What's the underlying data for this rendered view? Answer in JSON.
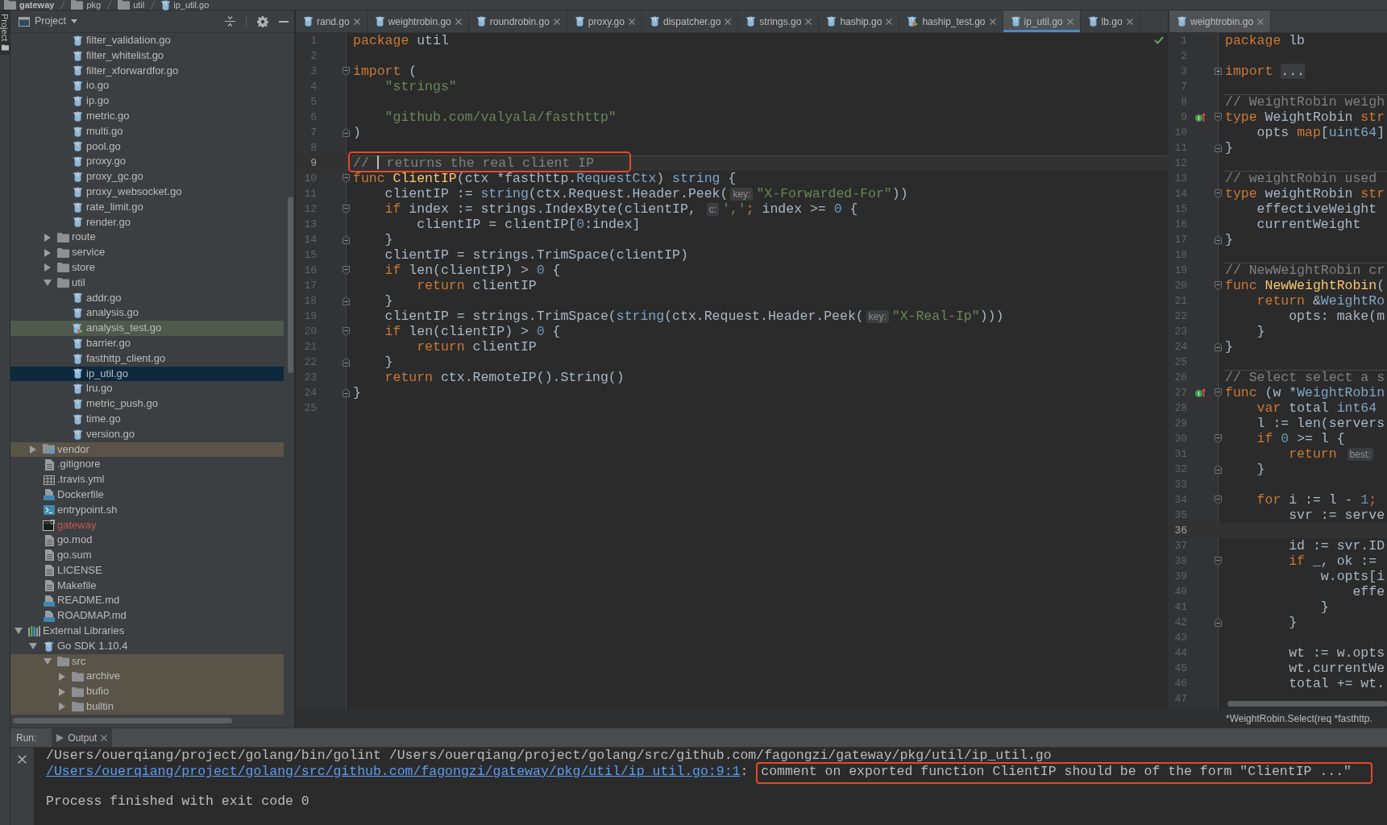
{
  "breadcrumb": [
    {
      "label": "gateway",
      "kind": "project"
    },
    {
      "label": "pkg",
      "kind": "folder"
    },
    {
      "label": "util",
      "kind": "folder"
    },
    {
      "label": "ip_util.go",
      "kind": "go"
    }
  ],
  "tool_strip": [
    {
      "label": "Project",
      "selected": true
    }
  ],
  "project_panel": {
    "title": "Project",
    "tree": [
      {
        "children": [
          {
            "children": [
              {
                "children": [
                  {
                    "label": "filter_validation.go",
                    "kind": "go",
                    "selected": false
                  },
                  {
                    "label": "filter_whitelist.go",
                    "kind": "go",
                    "selected": false
                  },
                  {
                    "label": "filter_xforwardfor.go",
                    "kind": "go",
                    "selected": false
                  },
                  {
                    "label": "io.go",
                    "kind": "go",
                    "selected": false
                  },
                  {
                    "label": "ip.go",
                    "kind": "go",
                    "selected": false
                  },
                  {
                    "label": "metric.go",
                    "kind": "go",
                    "selected": false
                  },
                  {
                    "label": "multi.go",
                    "kind": "go",
                    "selected": false
                  },
                  {
                    "label": "pool.go",
                    "kind": "go",
                    "selected": false
                  },
                  {
                    "label": "proxy.go",
                    "kind": "go",
                    "selected": false
                  },
                  {
                    "label": "proxy_gc.go",
                    "kind": "go",
                    "selected": false
                  },
                  {
                    "label": "proxy_websocket.go",
                    "kind": "go",
                    "selected": false
                  },
                  {
                    "label": "rate_limit.go",
                    "kind": "go",
                    "selected": false
                  },
                  {
                    "label": "render.go",
                    "kind": "go",
                    "selected": false
                  }
                ]
              },
              {
                "label": "route",
                "kind": "folder",
                "expanded": false,
                "selected": false
              },
              {
                "label": "service",
                "kind": "folder",
                "expanded": false,
                "selected": false
              },
              {
                "label": "store",
                "kind": "folder",
                "expanded": false,
                "selected": false
              },
              {
                "label": "util",
                "kind": "folder",
                "expanded": true,
                "selected": false,
                "children": [
                  {
                    "label": "addr.go",
                    "kind": "go",
                    "selected": false
                  },
                  {
                    "label": "analysis.go",
                    "kind": "go",
                    "selected": false
                  },
                  {
                    "label": "analysis_test.go",
                    "kind": "go_test",
                    "test_scope": true,
                    "selected": false
                  },
                  {
                    "label": "barrier.go",
                    "kind": "go",
                    "selected": false
                  },
                  {
                    "label": "fasthttp_client.go",
                    "kind": "go",
                    "selected": false
                  },
                  {
                    "label": "ip_util.go",
                    "kind": "go",
                    "selected": true
                  },
                  {
                    "label": "lru.go",
                    "kind": "go",
                    "selected": false
                  },
                  {
                    "label": "metric_push.go",
                    "kind": "go",
                    "selected": false
                  },
                  {
                    "label": "time.go",
                    "kind": "go",
                    "selected": false
                  },
                  {
                    "label": "version.go",
                    "kind": "go",
                    "selected": false
                  }
                ]
              }
            ]
          },
          {
            "label": "vendor",
            "kind": "vendor_folder",
            "expanded": false,
            "library_scope": true,
            "selected": false
          },
          {
            "label": ".gitignore",
            "kind": "text",
            "selected": false
          },
          {
            "label": ".travis.yml",
            "kind": "table",
            "selected": false
          },
          {
            "label": "Dockerfile",
            "kind": "docker",
            "selected": false
          },
          {
            "label": "entrypoint.sh",
            "kind": "shell",
            "selected": false
          },
          {
            "label": "gateway",
            "kind": "binary",
            "color": "#c75450",
            "selected": false
          },
          {
            "label": "go.mod",
            "kind": "text",
            "selected": false
          },
          {
            "label": "go.sum",
            "kind": "text",
            "selected": false
          },
          {
            "label": "LICENSE",
            "kind": "text",
            "selected": false
          },
          {
            "label": "Makefile",
            "kind": "text",
            "selected": false
          },
          {
            "label": "README.md",
            "kind": "markdown",
            "selected": false
          },
          {
            "label": "ROADMAP.md",
            "kind": "markdown",
            "selected": false
          }
        ]
      },
      {
        "label": "External Libraries",
        "kind": "libraries",
        "expanded": true,
        "selected": false,
        "children": [
          {
            "label": "Go SDK 1.10.4",
            "kind": "sdk",
            "expanded": true,
            "selected": false,
            "children": [
              {
                "label": "src",
                "kind": "folder",
                "expanded": true,
                "library_scope": true,
                "selected": false,
                "children": [
                  {
                    "label": "archive",
                    "kind": "folder",
                    "expanded": false,
                    "library_scope": true,
                    "selected": false
                  },
                  {
                    "label": "bufio",
                    "kind": "folder",
                    "expanded": false,
                    "library_scope": true,
                    "selected": false
                  },
                  {
                    "label": "builtin",
                    "kind": "folder",
                    "expanded": false,
                    "library_scope": true,
                    "selected": false
                  }
                ]
              }
            ]
          }
        ]
      }
    ]
  },
  "editors": [
    {
      "active": true,
      "inspection_passed": true,
      "tabs": [
        {
          "label": "rand.go",
          "kind": "go",
          "selected": false
        },
        {
          "label": "weightrobin.go",
          "kind": "go",
          "selected": false
        },
        {
          "label": "roundrobin.go",
          "kind": "go",
          "selected": false
        },
        {
          "label": "proxy.go",
          "kind": "go",
          "selected": false
        },
        {
          "label": "dispatcher.go",
          "kind": "go",
          "selected": false
        },
        {
          "label": "strings.go",
          "kind": "go",
          "selected": false
        },
        {
          "label": "haship.go",
          "kind": "go",
          "selected": false
        },
        {
          "label": "haship_test.go",
          "kind": "go_test",
          "selected": false
        },
        {
          "label": "ip_util.go",
          "kind": "go",
          "selected": true
        },
        {
          "label": "lb.go",
          "kind": "go",
          "selected": false
        }
      ],
      "lines": [
        {
          "number": "1",
          "tokens": [
            {
              "kind": "keyword",
              "text": "package"
            },
            {
              "kind": "plain",
              "text": " util"
            }
          ]
        },
        {
          "number": "2"
        },
        {
          "number": "3",
          "fold_start": true,
          "tokens": [
            {
              "kind": "keyword",
              "text": "import"
            },
            {
              "kind": "plain",
              "text": " ("
            }
          ]
        },
        {
          "number": "4",
          "tokens": [
            {
              "kind": "string",
              "text": "    \"strings\""
            }
          ]
        },
        {
          "number": "5"
        },
        {
          "number": "6",
          "tokens": [
            {
              "kind": "string",
              "text": "    \"github.com/valyala/fasthttp\""
            }
          ]
        },
        {
          "number": "7",
          "fold_end": true,
          "tokens": [
            {
              "kind": "plain",
              "text": ")"
            }
          ]
        },
        {
          "number": "8"
        },
        {
          "number": "9",
          "current": true,
          "separator": true,
          "boxed": true,
          "tokens": [
            {
              "kind": "comment",
              "text": "// "
            },
            {
              "kind": "caret"
            },
            {
              "kind": "comment",
              "text": " returns the real client IP"
            }
          ]
        },
        {
          "number": "10",
          "fold_start": true,
          "tokens": [
            {
              "kind": "keyword",
              "text": "func "
            },
            {
              "kind": "function",
              "text": "ClientIP"
            },
            {
              "kind": "plain",
              "text": "(ctx *fasthttp."
            },
            {
              "kind": "type",
              "text": "RequestCtx"
            },
            {
              "kind": "plain",
              "text": ") "
            },
            {
              "kind": "type",
              "text": "string"
            },
            {
              "kind": "plain",
              "text": " {"
            }
          ]
        },
        {
          "number": "11",
          "tokens": [
            {
              "kind": "plain",
              "text": "    clientIP := "
            },
            {
              "kind": "type",
              "text": "string"
            },
            {
              "kind": "plain",
              "text": "(ctx.Request.Header.Peek("
            },
            {
              "kind": "hint",
              "text": "key:"
            },
            {
              "kind": "string",
              "text": "\"X-Forwarded-For\""
            },
            {
              "kind": "plain",
              "text": "))"
            }
          ]
        },
        {
          "number": "12",
          "fold_start": true,
          "tokens": [
            {
              "kind": "keyword",
              "text": "    if"
            },
            {
              "kind": "plain",
              "text": " index := strings.IndexByte(clientIP, "
            },
            {
              "kind": "hint",
              "text": "c:"
            },
            {
              "kind": "string",
              "text": "','"
            },
            {
              "kind": "keyword",
              "text": ";"
            },
            {
              "kind": "plain",
              "text": " index >= "
            },
            {
              "kind": "number",
              "text": "0"
            },
            {
              "kind": "plain",
              "text": " {"
            }
          ]
        },
        {
          "number": "13",
          "tokens": [
            {
              "kind": "plain",
              "text": "        clientIP = clientIP["
            },
            {
              "kind": "number",
              "text": "0"
            },
            {
              "kind": "plain",
              "text": ":index]"
            }
          ]
        },
        {
          "number": "14",
          "fold_end": true,
          "tokens": [
            {
              "kind": "plain",
              "text": "    }"
            }
          ]
        },
        {
          "number": "15",
          "tokens": [
            {
              "kind": "plain",
              "text": "    clientIP = strings.TrimSpace(clientIP)"
            }
          ]
        },
        {
          "number": "16",
          "fold_start": true,
          "tokens": [
            {
              "kind": "keyword",
              "text": "    if"
            },
            {
              "kind": "plain",
              "text": " len(clientIP) > "
            },
            {
              "kind": "number",
              "text": "0"
            },
            {
              "kind": "plain",
              "text": " {"
            }
          ]
        },
        {
          "number": "17",
          "tokens": [
            {
              "kind": "keyword",
              "text": "        return"
            },
            {
              "kind": "plain",
              "text": " clientIP"
            }
          ]
        },
        {
          "number": "18",
          "fold_end": true,
          "tokens": [
            {
              "kind": "plain",
              "text": "    }"
            }
          ]
        },
        {
          "number": "19",
          "tokens": [
            {
              "kind": "plain",
              "text": "    clientIP = strings.TrimSpace("
            },
            {
              "kind": "type",
              "text": "string"
            },
            {
              "kind": "plain",
              "text": "(ctx.Request.Header.Peek("
            },
            {
              "kind": "hint",
              "text": "key:"
            },
            {
              "kind": "string",
              "text": "\"X-Real-Ip\""
            },
            {
              "kind": "plain",
              "text": ")))"
            }
          ]
        },
        {
          "number": "20",
          "fold_start": true,
          "tokens": [
            {
              "kind": "keyword",
              "text": "    if"
            },
            {
              "kind": "plain",
              "text": " len(clientIP) > "
            },
            {
              "kind": "number",
              "text": "0"
            },
            {
              "kind": "plain",
              "text": " {"
            }
          ]
        },
        {
          "number": "21",
          "tokens": [
            {
              "kind": "keyword",
              "text": "        return"
            },
            {
              "kind": "plain",
              "text": " clientIP"
            }
          ]
        },
        {
          "number": "22",
          "fold_end": true,
          "tokens": [
            {
              "kind": "plain",
              "text": "    }"
            }
          ]
        },
        {
          "number": "23",
          "tokens": [
            {
              "kind": "keyword",
              "text": "    return"
            },
            {
              "kind": "plain",
              "text": " ctx.RemoteIP().String()"
            }
          ]
        },
        {
          "number": "24",
          "fold_end": true,
          "tokens": [
            {
              "kind": "plain",
              "text": "}"
            }
          ]
        },
        {
          "number": "25"
        }
      ]
    },
    {
      "active": false,
      "tabs": [
        {
          "label": "weightrobin.go",
          "kind": "go",
          "selected": true
        }
      ],
      "lines": [
        {
          "number": "1",
          "tokens": [
            {
              "kind": "keyword",
              "text": "package"
            },
            {
              "kind": "plain",
              "text": " lb"
            }
          ]
        },
        {
          "number": "2"
        },
        {
          "number": "3",
          "folded": true,
          "tokens": [
            {
              "kind": "keyword",
              "text": "import "
            },
            {
              "kind": "folded",
              "text": "..."
            }
          ]
        },
        {
          "number": "7"
        },
        {
          "number": "8",
          "separator": true,
          "tokens": [
            {
              "kind": "comment",
              "text": "// WeightRobin weigh"
            }
          ]
        },
        {
          "number": "9",
          "implemented": true,
          "fold_start": true,
          "tokens": [
            {
              "kind": "keyword",
              "text": "type"
            },
            {
              "kind": "plain",
              "text": " WeightRobin "
            },
            {
              "kind": "keyword",
              "text": "str"
            }
          ]
        },
        {
          "number": "10",
          "tokens": [
            {
              "kind": "plain",
              "text": "    opts "
            },
            {
              "kind": "keyword",
              "text": "map"
            },
            {
              "kind": "plain",
              "text": "["
            },
            {
              "kind": "type",
              "text": "uint64"
            },
            {
              "kind": "plain",
              "text": "]"
            }
          ]
        },
        {
          "number": "11",
          "fold_end": true,
          "tokens": [
            {
              "kind": "plain",
              "text": "}"
            }
          ]
        },
        {
          "number": "12"
        },
        {
          "number": "13",
          "separator": true,
          "tokens": [
            {
              "kind": "comment",
              "text": "// weightRobin used"
            }
          ]
        },
        {
          "number": "14",
          "fold_start": true,
          "tokens": [
            {
              "kind": "keyword",
              "text": "type"
            },
            {
              "kind": "plain",
              "text": " weightRobin "
            },
            {
              "kind": "keyword",
              "text": "str"
            }
          ]
        },
        {
          "number": "15",
          "tokens": [
            {
              "kind": "plain",
              "text": "    effectiveWeight"
            }
          ]
        },
        {
          "number": "16",
          "tokens": [
            {
              "kind": "plain",
              "text": "    currentWeight"
            }
          ]
        },
        {
          "number": "17",
          "fold_end": true,
          "tokens": [
            {
              "kind": "plain",
              "text": "}"
            }
          ]
        },
        {
          "number": "18"
        },
        {
          "number": "19",
          "separator": true,
          "tokens": [
            {
              "kind": "comment",
              "text": "// NewWeightRobin cr"
            }
          ]
        },
        {
          "number": "20",
          "fold_start": true,
          "tokens": [
            {
              "kind": "keyword",
              "text": "func "
            },
            {
              "kind": "function",
              "text": "NewWeightRobin"
            },
            {
              "kind": "plain",
              "text": "("
            }
          ]
        },
        {
          "number": "21",
          "tokens": [
            {
              "kind": "keyword",
              "text": "    return"
            },
            {
              "kind": "plain",
              "text": " &"
            },
            {
              "kind": "type",
              "text": "WeightRo"
            }
          ]
        },
        {
          "number": "22",
          "tokens": [
            {
              "kind": "plain",
              "text": "        opts: make(m"
            }
          ]
        },
        {
          "number": "23",
          "tokens": [
            {
              "kind": "plain",
              "text": "    }"
            }
          ]
        },
        {
          "number": "24",
          "fold_end": true,
          "tokens": [
            {
              "kind": "plain",
              "text": "}"
            }
          ]
        },
        {
          "number": "25"
        },
        {
          "number": "26",
          "separator": true,
          "tokens": [
            {
              "kind": "comment",
              "text": "// Select select a s"
            }
          ]
        },
        {
          "number": "27",
          "implemented": true,
          "fold_start": true,
          "tokens": [
            {
              "kind": "keyword",
              "text": "func"
            },
            {
              "kind": "plain",
              "text": " (w *"
            },
            {
              "kind": "type",
              "text": "WeightRobin"
            }
          ]
        },
        {
          "number": "28",
          "tokens": [
            {
              "kind": "keyword",
              "text": "    var"
            },
            {
              "kind": "plain",
              "text": " total "
            },
            {
              "kind": "type",
              "text": "int64"
            }
          ]
        },
        {
          "number": "29",
          "tokens": [
            {
              "kind": "plain",
              "text": "    l := len(servers"
            }
          ]
        },
        {
          "number": "30",
          "fold_start": true,
          "tokens": [
            {
              "kind": "keyword",
              "text": "    if "
            },
            {
              "kind": "number",
              "text": "0"
            },
            {
              "kind": "plain",
              "text": " >= l {"
            }
          ]
        },
        {
          "number": "31",
          "tokens": [
            {
              "kind": "keyword",
              "text": "        return "
            },
            {
              "kind": "hint",
              "text": "best:"
            }
          ]
        },
        {
          "number": "32",
          "fold_end": true,
          "tokens": [
            {
              "kind": "plain",
              "text": "    }"
            }
          ]
        },
        {
          "number": "33"
        },
        {
          "number": "34",
          "fold_start": true,
          "tokens": [
            {
              "kind": "keyword",
              "text": "    for"
            },
            {
              "kind": "plain",
              "text": " i := l - "
            },
            {
              "kind": "number",
              "text": "1"
            },
            {
              "kind": "keyword",
              "text": ";"
            }
          ]
        },
        {
          "number": "35",
          "tokens": [
            {
              "kind": "plain",
              "text": "        svr := serve"
            }
          ]
        },
        {
          "number": "36",
          "current": true
        },
        {
          "number": "37",
          "tokens": [
            {
              "kind": "plain",
              "text": "        id := svr.ID"
            }
          ]
        },
        {
          "number": "38",
          "fold_start": true,
          "tokens": [
            {
              "kind": "keyword",
              "text": "        if"
            },
            {
              "kind": "plain",
              "text": " _, ok :="
            }
          ]
        },
        {
          "number": "39",
          "tokens": [
            {
              "kind": "plain",
              "text": "            w.opts[i"
            }
          ]
        },
        {
          "number": "40",
          "tokens": [
            {
              "kind": "plain",
              "text": "                effe"
            }
          ]
        },
        {
          "number": "41",
          "tokens": [
            {
              "kind": "plain",
              "text": "            }"
            }
          ]
        },
        {
          "number": "42",
          "fold_end": true,
          "tokens": [
            {
              "kind": "plain",
              "text": "        }"
            }
          ]
        },
        {
          "number": "43"
        },
        {
          "number": "44",
          "tokens": [
            {
              "kind": "plain",
              "text": "        wt := w.opts"
            }
          ]
        },
        {
          "number": "45",
          "tokens": [
            {
              "kind": "plain",
              "text": "        wt.currentWe"
            }
          ]
        },
        {
          "number": "46",
          "tokens": [
            {
              "kind": "plain",
              "text": "        total += wt."
            }
          ]
        },
        {
          "number": "47"
        }
      ],
      "breadcrumb": "*WeightRobin.Select(req *fasthttp."
    }
  ],
  "run_panel": {
    "label": "Run:",
    "tabs": [
      {
        "label": "Output",
        "selected": true
      }
    ],
    "lines": [
      {
        "segments": [
          {
            "kind": "text",
            "text": "/Users/ouerqiang/project/golang/bin/golint /Users/ouerqiang/project/golang/src/github.com/fagongzi/gateway/pkg/util/ip_util.go"
          }
        ]
      },
      {
        "segments": [
          {
            "kind": "link",
            "text": "/Users/ouerqiang/project/golang/src/github.com/fagongzi/gateway/pkg/util/ip_util.go:9:1"
          },
          {
            "kind": "text",
            "text": ": "
          },
          {
            "kind": "text",
            "text": "comment on exported function ClientIP should be of the form \"ClientIP ...\"",
            "boxed": true
          }
        ]
      },
      {
        "blank_before": true,
        "segments": [
          {
            "kind": "text",
            "text": "Process finished with exit code 0"
          }
        ]
      }
    ]
  }
}
